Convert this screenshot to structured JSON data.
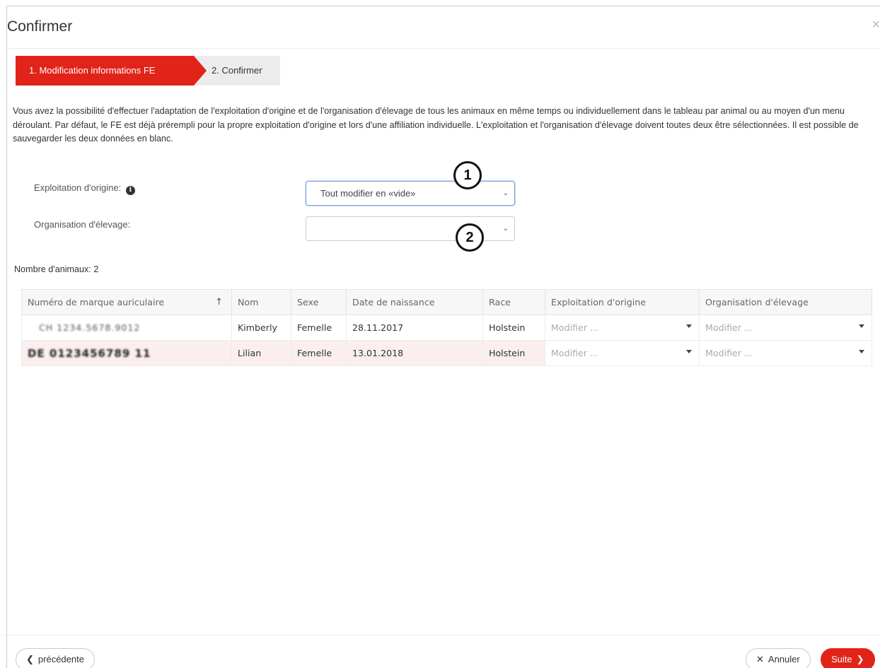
{
  "dialog": {
    "title": "Confirmer",
    "close_symbol": "×"
  },
  "steps": [
    {
      "label": "1. Modification informations FE",
      "active": true
    },
    {
      "label": "2. Confirmer",
      "active": false
    }
  ],
  "intro": "Vous avez la possibilité d'effectuer l'adaptation de l'exploitation d'origine et de l'organisation d'élevage de tous les animaux en même temps ou individuellement dans le tableau par animal ou au moyen d'un menu déroulant. Par défaut, le FE est déjà prérempli pour la propre exploitation d'origine et lors d'une affiliation individuelle. L'exploitation et l'organisation d'élevage doivent toutes deux être sélectionnées. Il est possible de sauvegarder les deux données en blanc.",
  "form": {
    "origin_label": "Exploitation d'origine:",
    "origin_info_icon": "info-circle-icon",
    "origin_value": "Tout modifier en «vide»",
    "breeding_label": "Organisation d'élevage:",
    "breeding_value": ""
  },
  "callouts": [
    "1",
    "2"
  ],
  "count": {
    "label": "Nombre d'animaux:",
    "value": "2"
  },
  "table": {
    "columns": [
      "Numéro de marque auriculaire",
      "Nom",
      "Sexe",
      "Date de naissance",
      "Race",
      "Exploitation d'origine",
      "Organisation d'élevage"
    ],
    "sort_symbol": "↑",
    "rows": [
      {
        "ear_tag": "CH 1234.5678.9012",
        "name": "Kimberly",
        "sex": "Femelle",
        "birth": "28.11.2017",
        "breed": "Holstein",
        "origin": "Modifier ...",
        "org": "Modifier ..."
      },
      {
        "ear_tag": "DE 0123456789 11",
        "name": "Lilian",
        "sex": "Femelle",
        "birth": "13.01.2018",
        "breed": "Holstein",
        "origin": "Modifier ...",
        "org": "Modifier ..."
      }
    ]
  },
  "footer": {
    "prev_label": "précédente",
    "cancel_label": "Annuler",
    "next_label": "Suite"
  }
}
